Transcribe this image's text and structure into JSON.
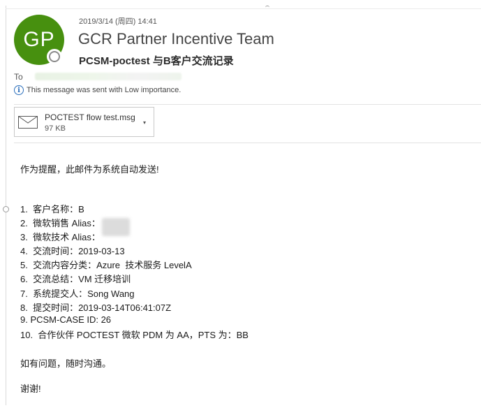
{
  "header": {
    "avatar_initials": "GP",
    "date": "2019/3/14 (周四) 14:41",
    "sender": "GCR Partner Incentive Team",
    "subject": "PCSM-poctest 与B客户交流记录",
    "to_label": "To",
    "importance_note": "This message was sent with Low importance.",
    "info_icon": "i"
  },
  "attachment": {
    "name": "POCTEST flow test.msg",
    "size": "97 KB",
    "caret": "▾"
  },
  "message": {
    "greeting": "作为提醒，此邮件为系统自动发送!",
    "items": [
      "1.  客户名称：B",
      "2.  微软销售 Alias：",
      "3.  微软技术 Alias：",
      "4.  交流时间：2019-03-13",
      "5.  交流内容分类：Azure  技术服务 LevelA",
      "6.  交流总结：VM 迁移培训",
      "7.  系统提交人：Song Wang",
      "8.  提交时间：2019-03-14T06:41:07Z",
      "9. PCSM-CASE ID: 26",
      "10.  合作伙伴 POCTEST 微软 PDM 为 AA，PTS 为：BB"
    ],
    "closing1": "如有问题，随时沟通。",
    "closing2": "谢谢!"
  },
  "colors": {
    "avatar_bg": "#47900f",
    "info_accent": "#2a6ebb"
  }
}
